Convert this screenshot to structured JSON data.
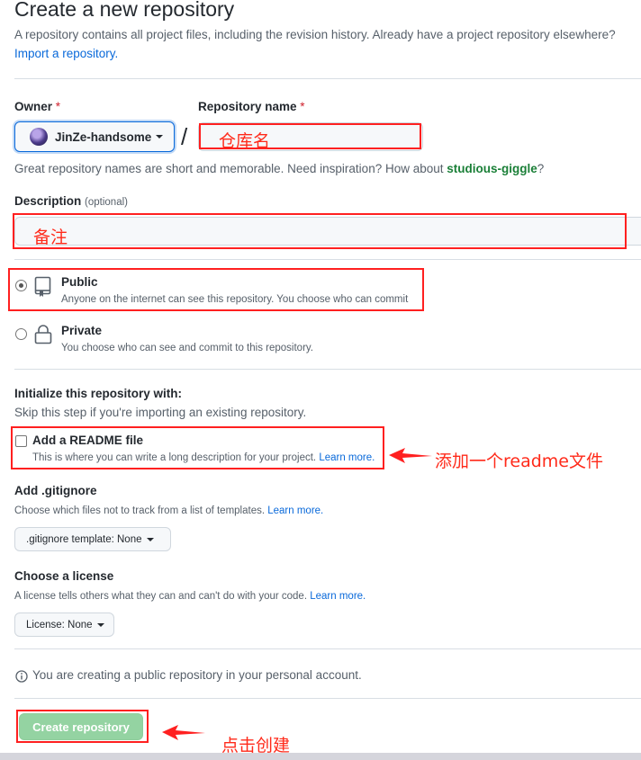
{
  "page": {
    "title": "Create a new repository",
    "subtitle": "A repository contains all project files, including the revision history. Already have a project repository elsewhere?",
    "import_link": "Import a repository."
  },
  "owner": {
    "label": "Owner",
    "required_mark": "*",
    "value": "JinZe-handsome"
  },
  "repo_name": {
    "label": "Repository name",
    "required_mark": "*",
    "slash": "/",
    "value": ""
  },
  "name_hint": {
    "text": "Great repository names are short and memorable. Need inspiration? How about ",
    "suggestion": "studious-giggle",
    "suffix": "?"
  },
  "description": {
    "label": "Description",
    "optional": "(optional)",
    "value": ""
  },
  "visibility": {
    "public": {
      "title": "Public",
      "desc": "Anyone on the internet can see this repository. You choose who can commit",
      "selected": true
    },
    "private": {
      "title": "Private",
      "desc": "You choose who can see and commit to this repository.",
      "selected": false
    }
  },
  "init": {
    "heading": "Initialize this repository with:",
    "hint": "Skip this step if you're importing an existing repository.",
    "readme_label": "Add a README file",
    "readme_desc": "This is where you can write a long description for your project.",
    "readme_learn_more": "Learn more."
  },
  "gitignore": {
    "heading": "Add .gitignore",
    "hint": "Choose which files not to track from a list of templates.",
    "learn_more": "Learn more.",
    "selected": ".gitignore template: None"
  },
  "license": {
    "heading": "Choose a license",
    "hint": "A license tells others what they can and can't do with your code.",
    "learn_more": "Learn more.",
    "selected": "License: None"
  },
  "notice": {
    "icon": "info-icon",
    "text": "You are creating a public repository in your personal account."
  },
  "submit": {
    "label": "Create repository"
  },
  "annotations": {
    "repo_name": "仓库名",
    "description": "备注",
    "readme": "添加一个readme文件",
    "create": "点击创建"
  },
  "colors": {
    "annotation_red": "#ff2020",
    "link_blue": "#0969da",
    "button_green_disabled": "#94d3a2",
    "suggestion_green": "#1a7f37"
  }
}
